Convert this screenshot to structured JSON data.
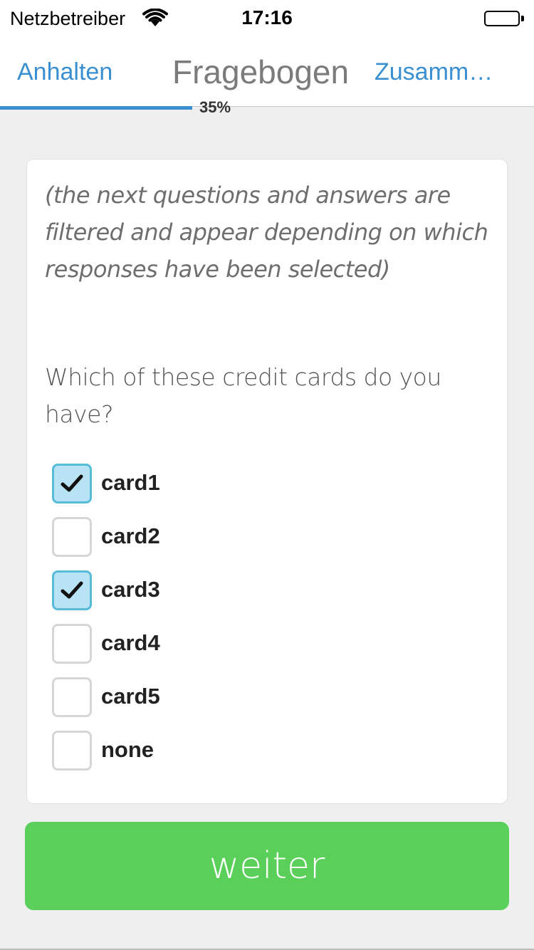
{
  "status_bar": {
    "carrier": "Netzbetreiber",
    "time": "17:16",
    "wifi_icon": "wifi-icon",
    "battery_icon": "battery-icon"
  },
  "nav": {
    "left_label": "Anhalten",
    "title": "Fragebogen",
    "right_label": "Zusamm…"
  },
  "progress": {
    "percent": 35,
    "label": "35%"
  },
  "survey": {
    "hint": "(the next questions and answers are filtered and appear depending on which responses have been selected)",
    "question": "Which of these credit cards do you have?",
    "options": [
      {
        "label": "card1",
        "checked": true
      },
      {
        "label": "card2",
        "checked": false
      },
      {
        "label": "card3",
        "checked": true
      },
      {
        "label": "card4",
        "checked": false
      },
      {
        "label": "card5",
        "checked": false
      },
      {
        "label": "none",
        "checked": false
      }
    ]
  },
  "next_button": {
    "label": "weiter"
  },
  "colors": {
    "accent": "#3a8fd0",
    "button": "#5ad05a",
    "checked_fill": "#b7e3f4",
    "checked_border": "#58bcd9"
  }
}
